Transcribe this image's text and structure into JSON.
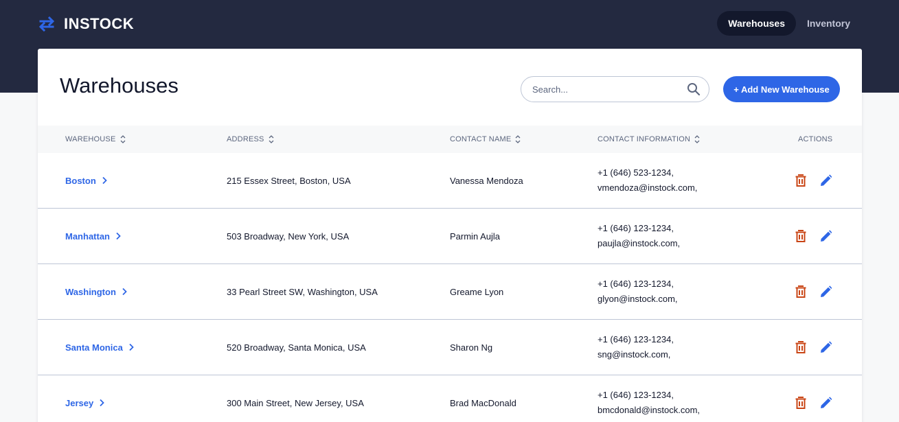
{
  "app": {
    "logo_text": "INSTOCK"
  },
  "nav": {
    "items": [
      {
        "label": "Warehouses"
      },
      {
        "label": "Inventory"
      }
    ]
  },
  "page": {
    "title": "Warehouses"
  },
  "search": {
    "placeholder": "Search..."
  },
  "add_button": {
    "label": "+ Add New Warehouse"
  },
  "table": {
    "columns": [
      "WAREHOUSE",
      "ADDRESS",
      "CONTACT NAME",
      "CONTACT INFORMATION",
      "ACTIONS"
    ],
    "rows": [
      {
        "warehouse": "Boston",
        "address": "215 Essex Street, Boston, USA",
        "contact_name": "Vanessa Mendoza",
        "phone": "+1 (646) 523-1234,",
        "email": "vmendoza@instock.com,"
      },
      {
        "warehouse": "Manhattan",
        "address": "503 Broadway, New York, USA",
        "contact_name": "Parmin Aujla",
        "phone": "+1 (646) 123-1234,",
        "email": "paujla@instock.com,"
      },
      {
        "warehouse": "Washington",
        "address": "33 Pearl Street SW, Washington, USA",
        "contact_name": "Greame Lyon",
        "phone": "+1 (646) 123-1234,",
        "email": "glyon@instock.com,"
      },
      {
        "warehouse": "Santa Monica",
        "address": "520 Broadway, Santa Monica, USA",
        "contact_name": "Sharon Ng",
        "phone": "+1 (646) 123-1234,",
        "email": "sng@instock.com,"
      },
      {
        "warehouse": "Jersey",
        "address": "300 Main Street, New Jersey, USA",
        "contact_name": "Brad MacDonald",
        "phone": "+1 (646) 123-1234,",
        "email": "bmcdonald@instock.com,"
      }
    ]
  },
  "colors": {
    "header": "#232940",
    "accent": "#2e66e6",
    "delete": "#c94515",
    "text": "#13182c",
    "muted": "#5c667e"
  }
}
